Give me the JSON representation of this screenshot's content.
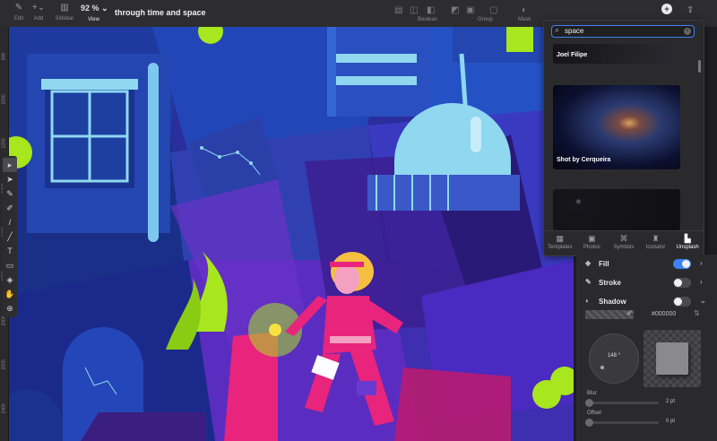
{
  "toolbar": {
    "edit": "Edit",
    "add": "Add",
    "sidebar": "Sidebar",
    "zoom_value": "92 %",
    "view": "View",
    "document_title": "through time and space",
    "boolean": "Boolean",
    "group": "Group",
    "mask": "Mask"
  },
  "ruler": [
    "800",
    "1000",
    "1200",
    "1400",
    "1600",
    "1800",
    "2000",
    "2200",
    "2400"
  ],
  "tools": [
    {
      "icon": "select-icon",
      "glyph": "▸"
    },
    {
      "icon": "direct-select-icon",
      "glyph": "➤"
    },
    {
      "icon": "vector-icon",
      "glyph": "✎"
    },
    {
      "icon": "brush-icon",
      "glyph": "✐"
    },
    {
      "icon": "pen-icon",
      "glyph": "/"
    },
    {
      "icon": "pencil-icon",
      "glyph": "╱"
    },
    {
      "icon": "text-icon",
      "glyph": "T"
    },
    {
      "icon": "rectangle-icon",
      "glyph": "▭"
    },
    {
      "icon": "fill-bucket-icon",
      "glyph": "◈"
    },
    {
      "icon": "hand-icon",
      "glyph": "✋"
    },
    {
      "icon": "zoom-icon",
      "glyph": "⊕"
    }
  ],
  "library": {
    "search_value": "space",
    "results": [
      {
        "caption": "Joel Filipe"
      },
      {
        "caption": "Shot by Cerqueira"
      },
      {
        "caption": ""
      }
    ],
    "tabs": [
      {
        "label": "Templates",
        "glyph": "▦"
      },
      {
        "label": "Photos",
        "glyph": "▣"
      },
      {
        "label": "Symbols",
        "glyph": "⌘"
      },
      {
        "label": "Iconator",
        "glyph": "♜"
      },
      {
        "label": "Unsplash",
        "glyph": "▙"
      }
    ]
  },
  "inspector": {
    "fill": "Fill",
    "stroke": "Stroke",
    "shadow": "Shadow",
    "shadow_color": "#000000",
    "angle": "148 °",
    "blur_label": "Blur",
    "blur_value": "2 pt",
    "offset_label": "Offset",
    "offset_value": "0 pt",
    "toggles": {
      "fill": true,
      "stroke": false,
      "shadow": false
    }
  },
  "colors": {
    "accent": "#3b82f6",
    "art_bg": "#2a2d9c",
    "pink": "#e8247c",
    "lime": "#a8e61e"
  }
}
